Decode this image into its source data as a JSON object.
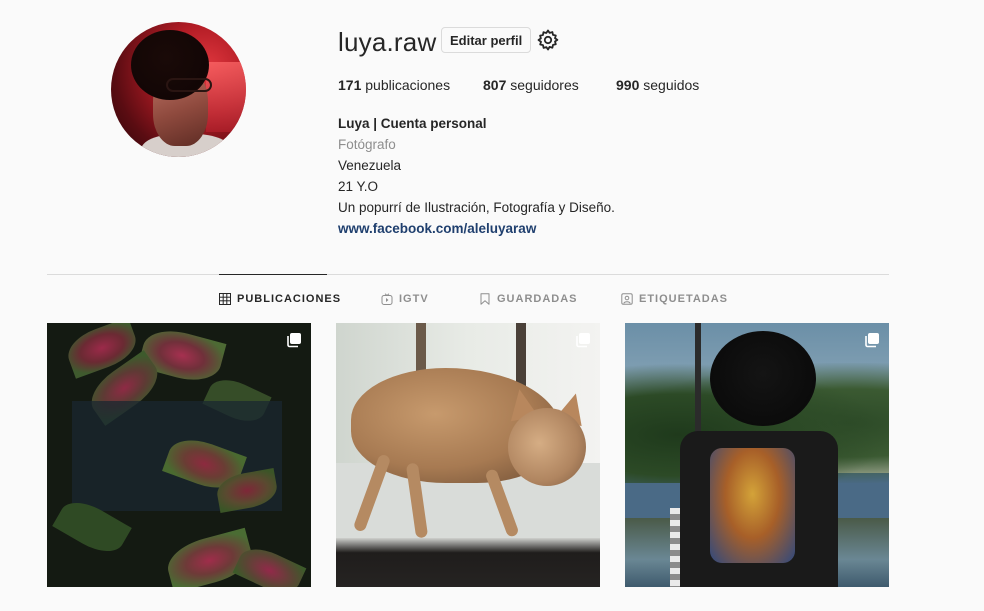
{
  "profile": {
    "username": "luya.raw",
    "edit_label": "Editar perfil",
    "stats": {
      "posts_count": "171",
      "posts_label": "publicaciones",
      "followers_count": "807",
      "followers_label": "seguidores",
      "following_count": "990",
      "following_label": "seguidos"
    },
    "bio": {
      "name": "Luya | Cuenta personal",
      "category": "Fotógrafo",
      "location": "Venezuela",
      "age": "21 Y.O",
      "description": "Un popurrí de Ilustración, Fotografía y Diseño.",
      "link": "www.facebook.com/aleluyaraw"
    }
  },
  "tabs": [
    {
      "label": "PUBLICACIONES",
      "icon": "grid-icon",
      "active": true
    },
    {
      "label": "IGTV",
      "icon": "igtv-icon",
      "active": false
    },
    {
      "label": "GUARDADAS",
      "icon": "bookmark-icon",
      "active": false
    },
    {
      "label": "ETIQUETADAS",
      "icon": "tag-person-icon",
      "active": false
    }
  ],
  "posts": [
    {
      "type": "carousel",
      "subject": "plants"
    },
    {
      "type": "carousel",
      "subject": "cat"
    },
    {
      "type": "carousel",
      "subject": "person"
    }
  ],
  "colors": {
    "background": "#fafafa",
    "text": "#262626",
    "muted": "#8e8e8e",
    "link": "#1f3f6e",
    "border": "#dbdbdb"
  }
}
